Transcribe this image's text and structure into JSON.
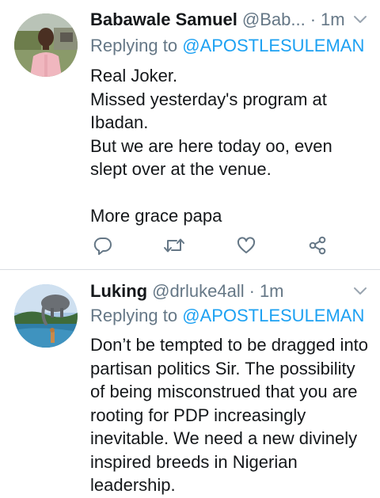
{
  "tweets": [
    {
      "name": "Babawale Samuel",
      "handle": "@Bab...",
      "separator": "·",
      "time": "1m",
      "replying_prefix": "Replying to ",
      "replying_to": "@APOSTLESULEMAN",
      "lines": [
        "Real Joker.",
        "Missed yesterday's program at",
        "Ibadan.",
        "But we are here today oo, even",
        "slept over at the venue.",
        "",
        "More grace papa"
      ],
      "actions": [
        "reply-icon",
        "retweet-icon",
        "like-icon",
        "share-icon"
      ]
    },
    {
      "name": "Luking",
      "handle": "@drluke4all",
      "separator": "·",
      "time": "1m",
      "replying_prefix": "Replying to ",
      "replying_to": "@APOSTLESULEMAN",
      "lines": [
        "Don’t be tempted to be dragged into",
        "partisan politics Sir.  The possibility",
        "of being misconstrued that you are",
        "rooting for PDP increasingly",
        "inevitable. We need a new divinely",
        "inspired breeds in Nigerian",
        "leadership."
      ]
    }
  ],
  "colors": {
    "text": "#14171a",
    "secondary": "#657786",
    "link": "#1da1f2",
    "divider": "#d9dde1"
  }
}
